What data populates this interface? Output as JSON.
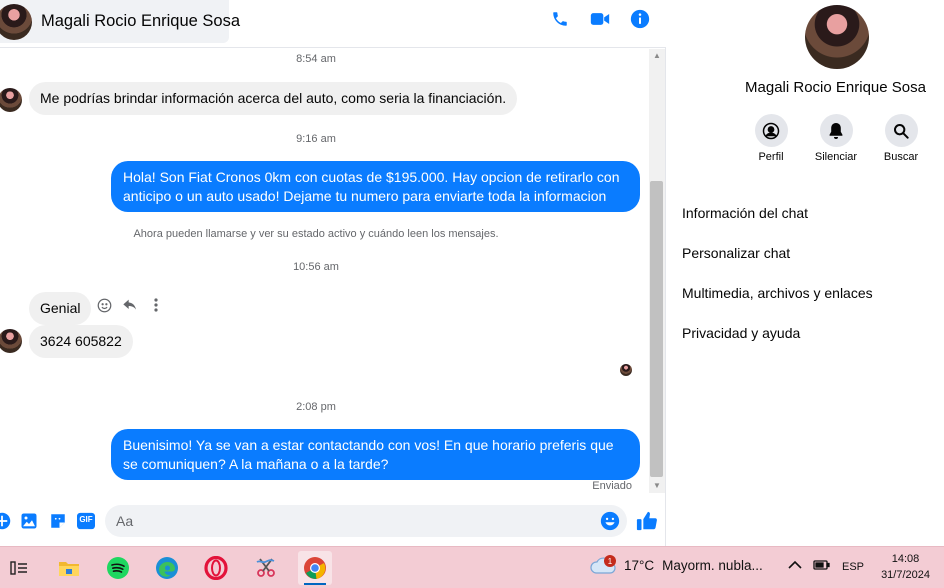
{
  "header": {
    "contact_name": "Magali Rocio Enrique Sosa",
    "icons": [
      "phone-icon",
      "video-camera-icon",
      "info-icon"
    ]
  },
  "messages": {
    "ts1": "8:54 am",
    "in1": "Me podrías brindar información acerca del auto, como seria la financiación.",
    "ts2": "9:16 am",
    "out1": "Hola! Son Fiat Cronos 0km con cuotas de $195.000. Hay opcion de retirarlo con anticipo o un auto usado! Dejame tu numero para enviarte toda la informacion",
    "system": "Ahora pueden llamarse y ver su estado activo y cuándo leen los mensajes.",
    "ts3": "10:56 am",
    "in2": "Genial",
    "in3": "3624 605822",
    "ts4": "2:08 pm",
    "out2": "Buenisimo! Ya se van a estar contactando con vos! En que horario preferis que se comuniquen? A la mañana o a la tarde?",
    "status": "Enviado"
  },
  "composer": {
    "placeholder": "Aa",
    "icons": [
      "plus-circle-icon",
      "image-icon",
      "sticker-icon",
      "gif-icon",
      "emoji-icon",
      "thumbs-up-icon"
    ],
    "gif_label": "GIF"
  },
  "info": {
    "name": "Magali Rocio Enrique Sosa",
    "actions": [
      {
        "label": "Perfil",
        "icon": "profile-icon"
      },
      {
        "label": "Silenciar",
        "icon": "bell-icon"
      },
      {
        "label": "Buscar",
        "icon": "search-icon"
      }
    ],
    "menu": [
      "Información del chat",
      "Personalizar chat",
      "Multimedia, archivos y enlaces",
      "Privacidad y ayuda"
    ]
  },
  "taskbar": {
    "apps": [
      "task-view-icon",
      "file-explorer-icon",
      "spotify-icon",
      "edge-icon",
      "opera-icon",
      "snipping-tool-icon",
      "chrome-icon"
    ],
    "weather_badge": "1",
    "temperature": "17°C",
    "weather_text": "Mayorm. nubla...",
    "language": "ESP",
    "time": "14:08",
    "date": "31/7/2024"
  },
  "colors": {
    "messenger_blue": "#0a7cff",
    "incoming_bubble": "#f0f0f0",
    "taskbar_bg": "#f3ccd4"
  }
}
